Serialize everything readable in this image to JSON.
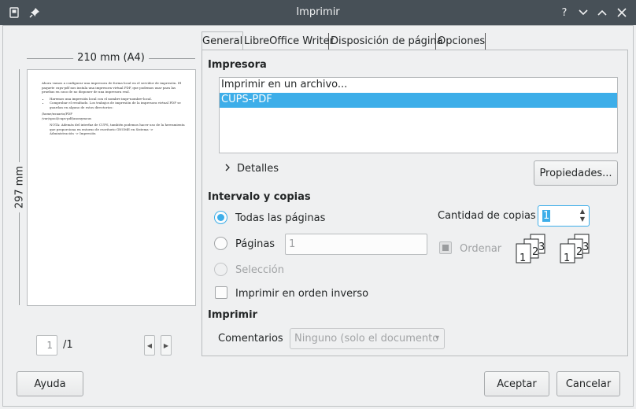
{
  "window": {
    "title": "Imprimir",
    "help_glyph": "?",
    "minimize_glyph": "⌄",
    "maximize_glyph": "⌃",
    "close_glyph": "✕"
  },
  "preview": {
    "width_label": "210 mm (A4)",
    "height_label": "297 mm",
    "page_text": [
      "Ahora vamos a configurar una impresora de forma local en el servidor de impresión. El paquete cups-pdf nos instala una impresora virtual PDF, que podemos usar para las pruebas en caso de no disponer de una impresora real.",
      "Haremos una impresión local con el nombre impr-nombre-local.",
      "Comprobar el resultado. Los trabajos de impresión de la impresora virtual PDF se guardan en alguno de estos directorios:",
      "/home/usuario/PDF",
      "/var/spool/cups-pdf/anonymous",
      "NOTA: Además del interfaz de CUPS, también podemos hacer uso de la herramienta que proporciona en entorno de escritorio GNOME en Sistema ->",
      "Administración -> Impresión"
    ],
    "current_page": "1",
    "total_pages": "/1"
  },
  "tabs": [
    "General",
    "LibreOffice Writer",
    "Disposición de página",
    "Opciones"
  ],
  "printer_section": {
    "title": "Impresora",
    "printers": [
      "Imprimir en un archivo...",
      "CUPS-PDF"
    ],
    "selected_index": 1,
    "details_label": "Detalles",
    "properties_button": "Propiedades..."
  },
  "range_section": {
    "title": "Intervalo y copias",
    "all_pages": "Todas las páginas",
    "pages": "Páginas",
    "pages_value": "1",
    "selection": "Selección",
    "reverse_order": "Imprimir en orden inverso",
    "copies_label": "Cantidad de copias",
    "copies_value": "1",
    "collate_label": "Ordenar"
  },
  "print_section": {
    "title": "Imprimir",
    "comments_label": "Comentarios",
    "comments_value": "Ninguno (solo el documento"
  },
  "footer": {
    "help_button": "Ayuda",
    "ok_button": "Aceptar",
    "cancel_button": "Cancelar"
  },
  "colors": {
    "accent": "#3daee9",
    "titlebar": "#475057",
    "background": "#eff0f1"
  }
}
